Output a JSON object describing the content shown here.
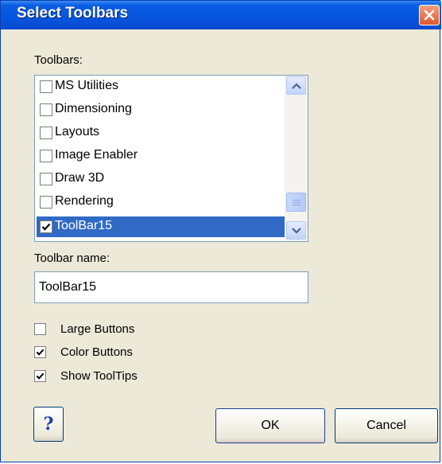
{
  "window": {
    "title": "Select Toolbars"
  },
  "toolbars_label": "Toolbars:",
  "toolbars_list": [
    {
      "label": "MS Utilities",
      "checked": false,
      "selected": false
    },
    {
      "label": "Dimensioning",
      "checked": false,
      "selected": false
    },
    {
      "label": "Layouts",
      "checked": false,
      "selected": false
    },
    {
      "label": "Image Enabler",
      "checked": false,
      "selected": false
    },
    {
      "label": "Draw 3D",
      "checked": false,
      "selected": false
    },
    {
      "label": "Rendering",
      "checked": false,
      "selected": false
    },
    {
      "label": "ToolBar15",
      "checked": true,
      "selected": true
    }
  ],
  "toolbar_name": {
    "label": "Toolbar name:",
    "value": "ToolBar15"
  },
  "options": [
    {
      "label": "Large Buttons",
      "checked": false
    },
    {
      "label": "Color Buttons",
      "checked": true
    },
    {
      "label": "Show ToolTips",
      "checked": true
    }
  ],
  "buttons": {
    "help": "?",
    "ok": "OK",
    "cancel": "Cancel"
  },
  "icons": {
    "close": "close-icon",
    "scroll_up": "arrow-up-icon",
    "scroll_down": "arrow-down-icon",
    "check": "checkmark-icon"
  },
  "colors": {
    "titlebar": "#0654de",
    "selection": "#316ac5",
    "dialog_bg": "#ece9d8",
    "close_button": "#e0572c"
  }
}
